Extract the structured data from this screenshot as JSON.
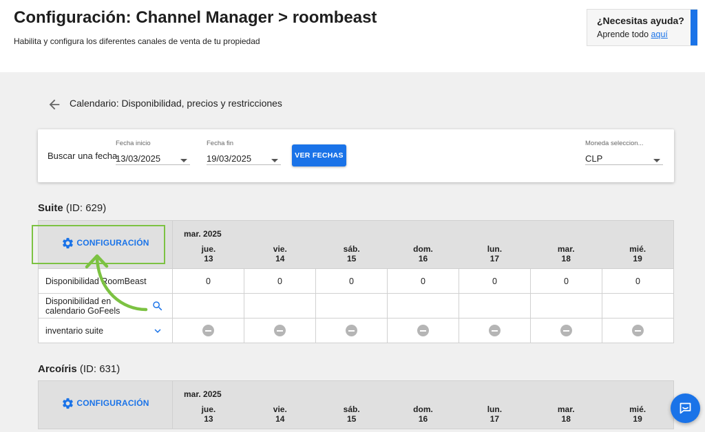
{
  "header": {
    "title": "Configuración: Channel Manager > roombeast",
    "subtitle": "Habilita y configura los diferentes canales de venta de tu propiedad"
  },
  "help": {
    "title": "¿Necesitas ayuda?",
    "text": "Aprende todo ",
    "link": "aquí"
  },
  "section": {
    "heading": "Calendario: Disponibilidad, precios y restricciones"
  },
  "filters": {
    "search_label": "Buscar una fecha",
    "start_label": "Fecha inicio",
    "start_value": "13/03/2025",
    "end_label": "Fecha fin",
    "end_value": "19/03/2025",
    "submit_label": "VER FECHAS",
    "currency_label": "Moneda seleccion...",
    "currency_value": "CLP"
  },
  "rooms": [
    {
      "name": "Suite",
      "id_text": "(ID: 629)",
      "config_label": "CONFIGURACIÓN",
      "month": "mar. 2025",
      "days": [
        {
          "dow": "jue.",
          "num": "13"
        },
        {
          "dow": "vie.",
          "num": "14"
        },
        {
          "dow": "sáb.",
          "num": "15"
        },
        {
          "dow": "dom.",
          "num": "16"
        },
        {
          "dow": "lun.",
          "num": "17"
        },
        {
          "dow": "mar.",
          "num": "18"
        },
        {
          "dow": "mié.",
          "num": "19"
        }
      ],
      "rows": {
        "availability_label": "Disponibilidad RoomBeast",
        "availability_values": [
          "0",
          "0",
          "0",
          "0",
          "0",
          "0",
          "0"
        ],
        "gofeels_label_1": "Disponibilidad en",
        "gofeels_label_2": "calendario GoFeels",
        "inventory_label": "inventario suite"
      }
    },
    {
      "name": "Arcoíris",
      "id_text": "(ID: 631)",
      "config_label": "CONFIGURACIÓN",
      "month": "mar. 2025",
      "days": [
        {
          "dow": "jue.",
          "num": "13"
        },
        {
          "dow": "vie.",
          "num": "14"
        },
        {
          "dow": "sáb.",
          "num": "15"
        },
        {
          "dow": "dom.",
          "num": "16"
        },
        {
          "dow": "lun.",
          "num": "17"
        },
        {
          "dow": "mar.",
          "num": "18"
        },
        {
          "dow": "mié.",
          "num": "19"
        }
      ]
    }
  ],
  "colors": {
    "accent": "#1a73e8",
    "highlight": "#7cc242",
    "header_bg": "#e0e0e0"
  }
}
